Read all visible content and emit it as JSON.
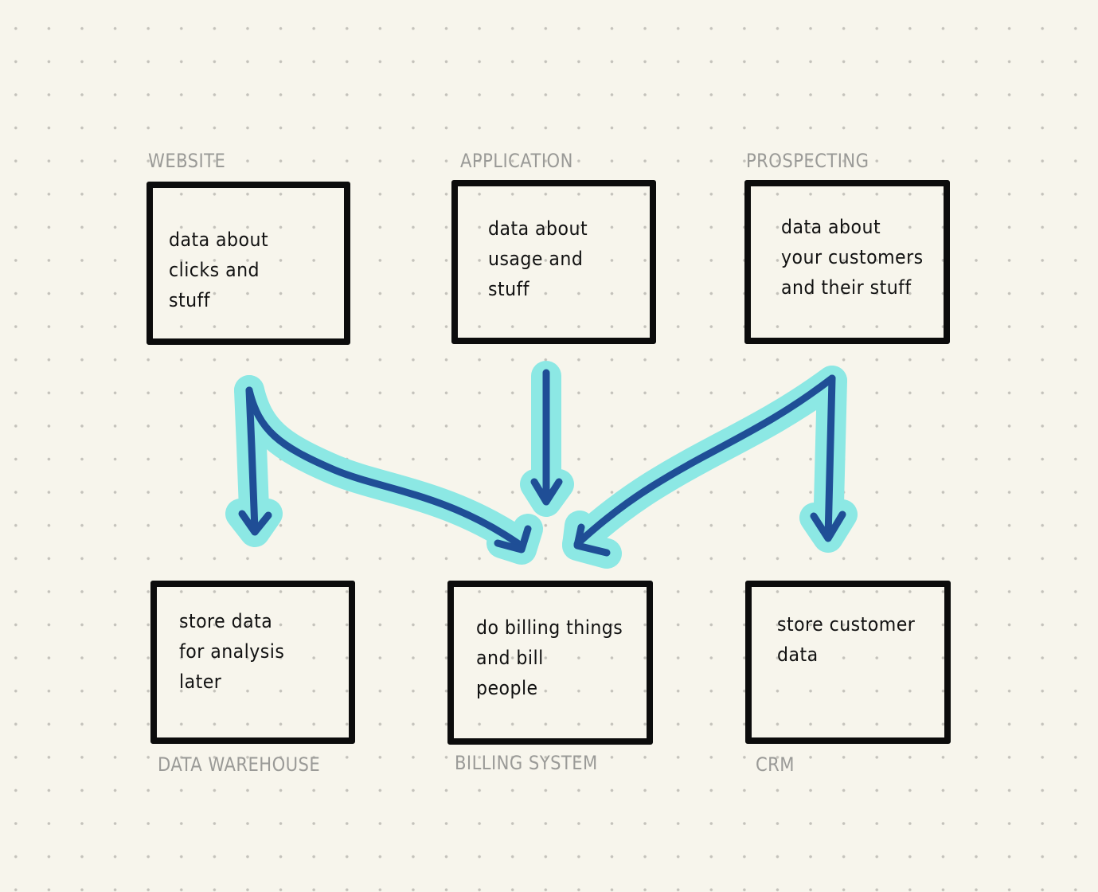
{
  "diagram": {
    "colors": {
      "background": "#f7f5ec",
      "box_stroke": "#0c0c0c",
      "label_text": "#9a9a97",
      "arrow_stroke": "#1f4e96",
      "arrow_highlight": "#8ce8e4"
    },
    "sources": [
      {
        "id": "website",
        "label": "WEBSITE",
        "text": "data about\nclicks and\n  stuff"
      },
      {
        "id": "application",
        "label": "APPLICATION",
        "text": "data about\nusage and\n stuff"
      },
      {
        "id": "prospecting",
        "label": "PROSPECTING",
        "text": "data about\nyour customers\nand their stuff"
      }
    ],
    "destinations": [
      {
        "id": "data-warehouse",
        "label": "DATA WAREHOUSE",
        "text": "store data\nfor analysis\nlater"
      },
      {
        "id": "billing-system",
        "label": "BILLING SYSTEM",
        "text": "do billing things\nand bill\npeople"
      },
      {
        "id": "crm",
        "label": "CRM",
        "text": "store customer\ndata"
      }
    ],
    "edges": [
      {
        "from": "website",
        "to": "data-warehouse"
      },
      {
        "from": "website",
        "to": "billing-system"
      },
      {
        "from": "application",
        "to": "billing-system"
      },
      {
        "from": "prospecting",
        "to": "billing-system"
      },
      {
        "from": "prospecting",
        "to": "crm"
      }
    ]
  }
}
